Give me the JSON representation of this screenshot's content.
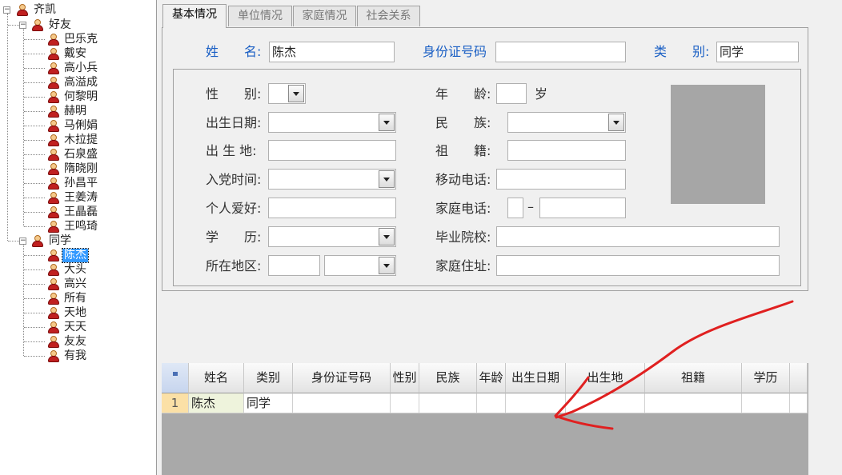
{
  "app": {
    "title": "",
    "accent_color": "#1a5fc4",
    "annotation_color": "#e02020"
  },
  "tree": {
    "root_label": "齐凯",
    "groups": [
      {
        "label": "好友",
        "items": [
          "巴乐克",
          "戴安",
          "高小兵",
          "高溢成",
          "何黎明",
          "赫明",
          "马俐娟",
          "木拉提",
          "石泉盛",
          "隋晓刚",
          "孙昌平",
          "王姜涛",
          "王晶磊",
          "王鸣琦"
        ]
      },
      {
        "label": "同学",
        "items": [
          "陈杰",
          "大头",
          "高兴",
          "所有",
          "天地",
          "天天",
          "友友",
          "有我"
        ],
        "selected": "陈杰"
      }
    ]
  },
  "tabs": [
    "基本情况",
    "单位情况",
    "家庭情况",
    "社会关系"
  ],
  "active_tab": "基本情况",
  "form": {
    "name_label": "姓　　名:",
    "name_value": "陈杰",
    "id_label": "身份证号码",
    "id_value": "",
    "type_label": "类　　别:",
    "type_value": "同学",
    "gender_label": "性　　别:",
    "birth_label": "出生日期:",
    "birthplace_label": "出 生 地:",
    "party_label": "入党时间:",
    "hobby_label": "个人爱好:",
    "edu_label": "学　　历:",
    "region_label": "所在地区:",
    "age_label": "年　　龄:",
    "age_unit": "岁",
    "ethnic_label": "民　　族:",
    "origin_label": "祖　　籍:",
    "mobile_label": "移动电话:",
    "home_phone_label": "家庭电话:",
    "phone_dash": "–",
    "school_label": "毕业院校:",
    "address_label": "家庭住址:",
    "photo_label": ""
  },
  "grid": {
    "corner_icon": "lock-icon",
    "columns": [
      "姓名",
      "类别",
      "身份证号码",
      "性别",
      "民族",
      "年龄",
      "出生日期",
      "出生地",
      "祖籍",
      "学历"
    ],
    "rows": [
      {
        "num": "1",
        "cells": [
          "陈杰",
          "同学",
          "",
          "",
          "",
          "",
          "",
          "",
          "",
          ""
        ]
      }
    ]
  }
}
